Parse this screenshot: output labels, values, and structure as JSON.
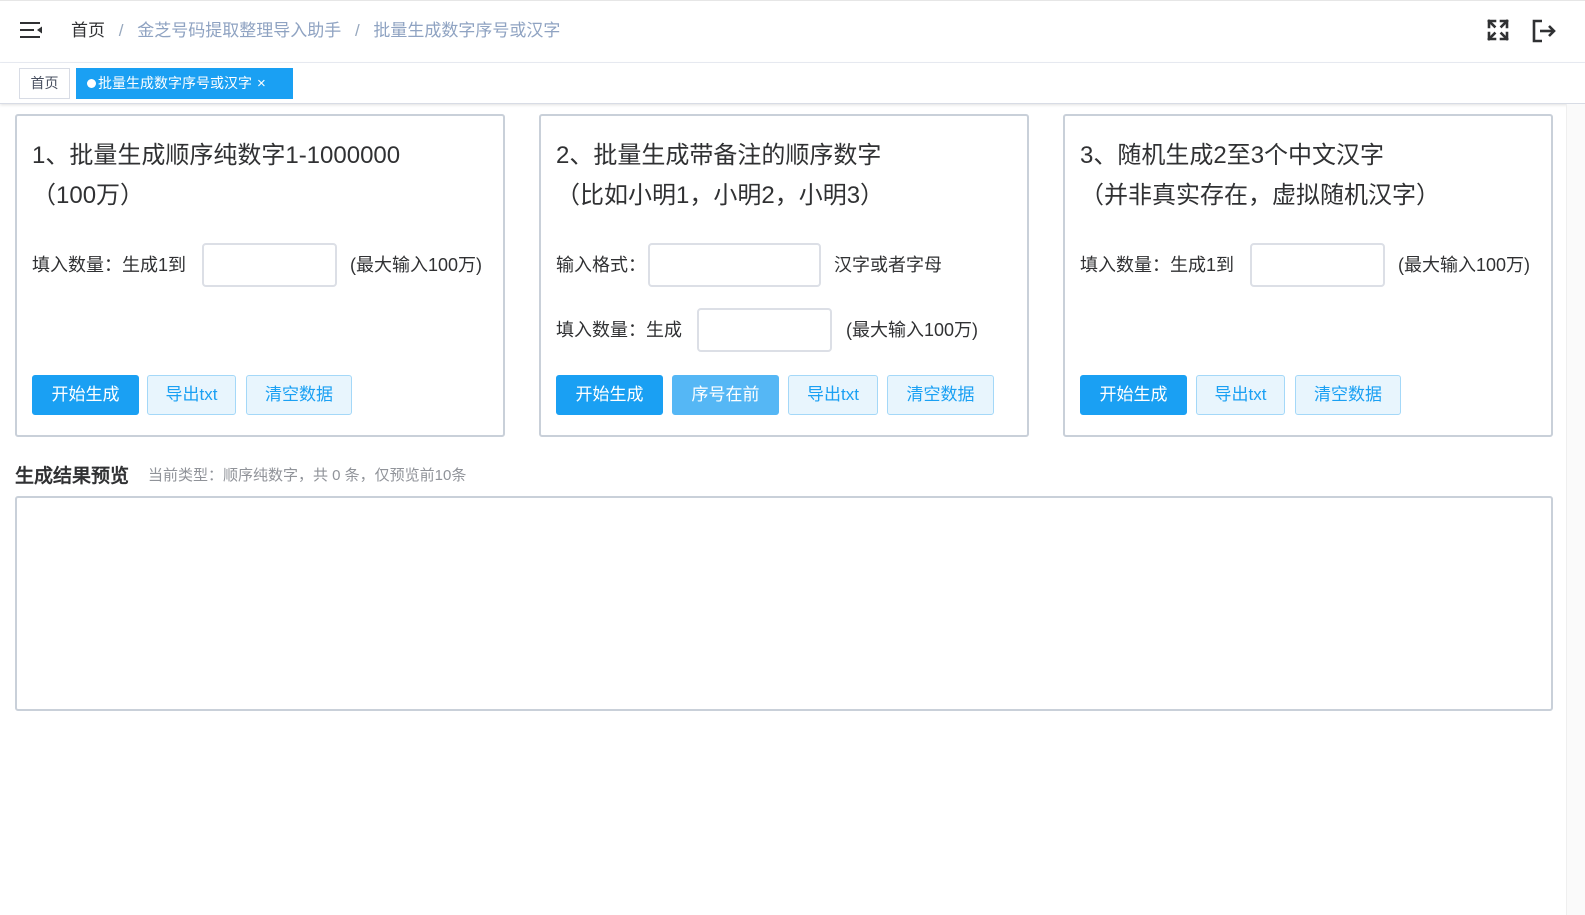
{
  "header": {
    "breadcrumb": [
      {
        "label": "首页"
      },
      {
        "label": "金芝号码提取整理导入助手"
      },
      {
        "label": "批量生成数字序号或汉字"
      }
    ],
    "separator": "/",
    "icons": {
      "menu": "hamburger-icon",
      "fullscreen": "fullscreen-icon",
      "logout": "logout-icon"
    }
  },
  "tags": {
    "home": "首页",
    "active": "批量生成数字序号或汉字",
    "close": "×"
  },
  "cards": [
    {
      "title_line1": "1、批量生成顺序纯数字1-1000000",
      "title_line2": "（100万）",
      "count_label": "填入数量：生成1到",
      "count_value": "",
      "count_hint": "(最大输入100万)",
      "buttons": {
        "start": "开始生成",
        "export": "导出txt",
        "clear": "清空数据"
      }
    },
    {
      "title_line1": "2、批量生成带备注的顺序数字",
      "title_line2": "（比如小明1，小明2，小明3）",
      "format_label": "输入格式：",
      "format_value": "",
      "format_hint": "汉字或者字母",
      "count_label": "填入数量：生成",
      "count_value": "",
      "count_hint": "(最大输入100万)",
      "buttons": {
        "start": "开始生成",
        "order": "序号在前",
        "export": "导出txt",
        "clear": "清空数据"
      }
    },
    {
      "title_line1": "3、随机生成2至3个中文汉字",
      "title_line2": "（并非真实存在，虚拟随机汉字）",
      "count_label": "填入数量：生成1到",
      "count_value": "",
      "count_hint": "(最大输入100万)",
      "buttons": {
        "start": "开始生成",
        "export": "导出txt",
        "clear": "清空数据"
      }
    }
  ],
  "result": {
    "title": "生成结果预览",
    "subtitle": "当前类型：顺序纯数字，共 0 条，仅预览前10条",
    "content": ""
  },
  "colors": {
    "primary": "#1aa0f3",
    "plain_bg": "#e8f5fd",
    "border": "#c9d0d9"
  }
}
